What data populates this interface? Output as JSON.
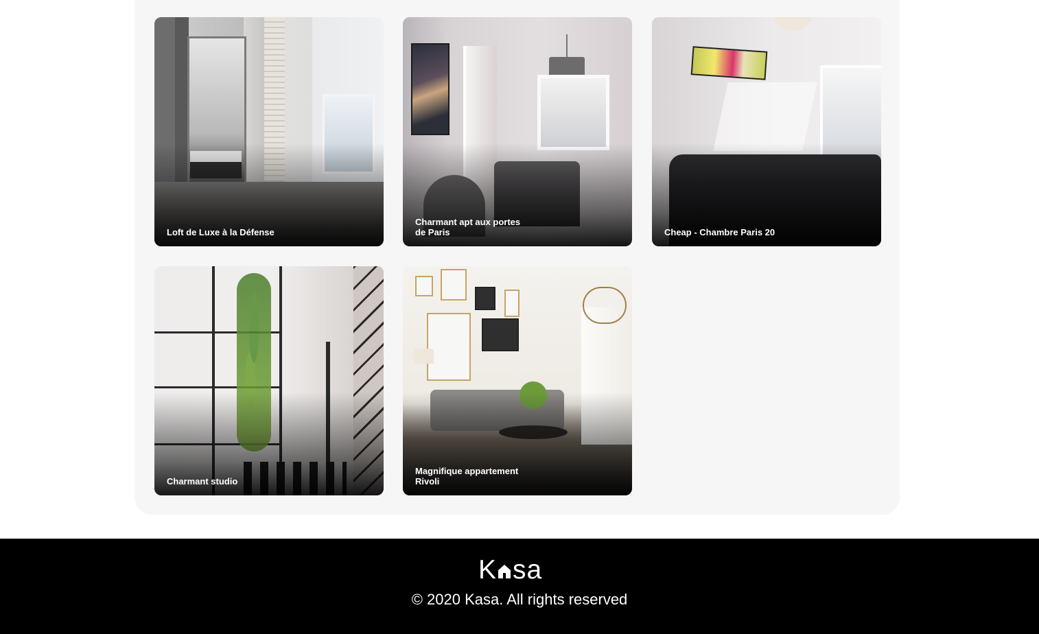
{
  "listings": [
    {
      "title": "Loft de Luxe à la Défense"
    },
    {
      "title": "Charmant apt aux portes de Paris"
    },
    {
      "title": "Cheap - Chambre Paris 20"
    },
    {
      "title": "Charmant studio"
    },
    {
      "title": "Magnifique appartement Rivoli"
    }
  ],
  "footer": {
    "logo_prefix": "K",
    "logo_suffix": "sa",
    "logo_icon": "house-icon",
    "copyright": "© 2020 Kasa. All rights reserved"
  },
  "colors": {
    "footer_bg": "#000000",
    "gallery_bg": "#f6f6f6",
    "card_title": "#ffffff"
  }
}
